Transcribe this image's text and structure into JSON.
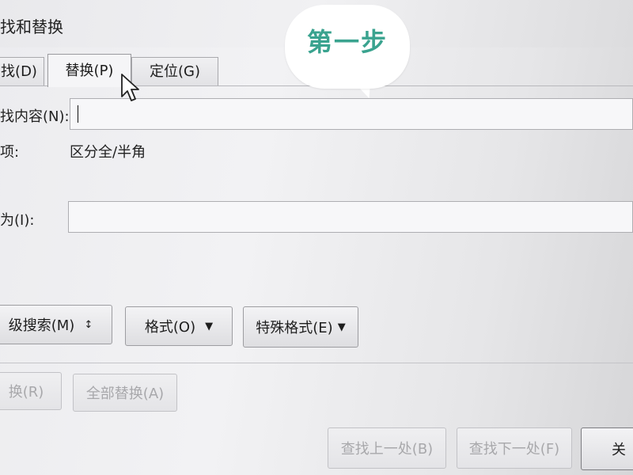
{
  "window": {
    "title": "找和替换"
  },
  "tabs": [
    {
      "label": "找(D)",
      "active": false
    },
    {
      "label": "替换(P)",
      "active": true
    },
    {
      "label": "定位(G)",
      "active": false
    }
  ],
  "find": {
    "label": "找内容(N):",
    "value": ""
  },
  "options": {
    "label": "项:",
    "value": "区分全/半角"
  },
  "replace": {
    "label": "为(I):",
    "value": ""
  },
  "option_buttons": {
    "more": "级搜索(M)",
    "more_icon": "double-chevron-icon",
    "format": "格式(O)",
    "special": "特殊格式(E)"
  },
  "action_buttons": {
    "replace": "换(R)",
    "replace_all": "全部替换(A)",
    "find_prev": "查找上一处(B)",
    "find_next": "查找下一处(F)",
    "close": "关"
  },
  "annotation": {
    "text": "第一步",
    "color": "#3aa38f"
  }
}
